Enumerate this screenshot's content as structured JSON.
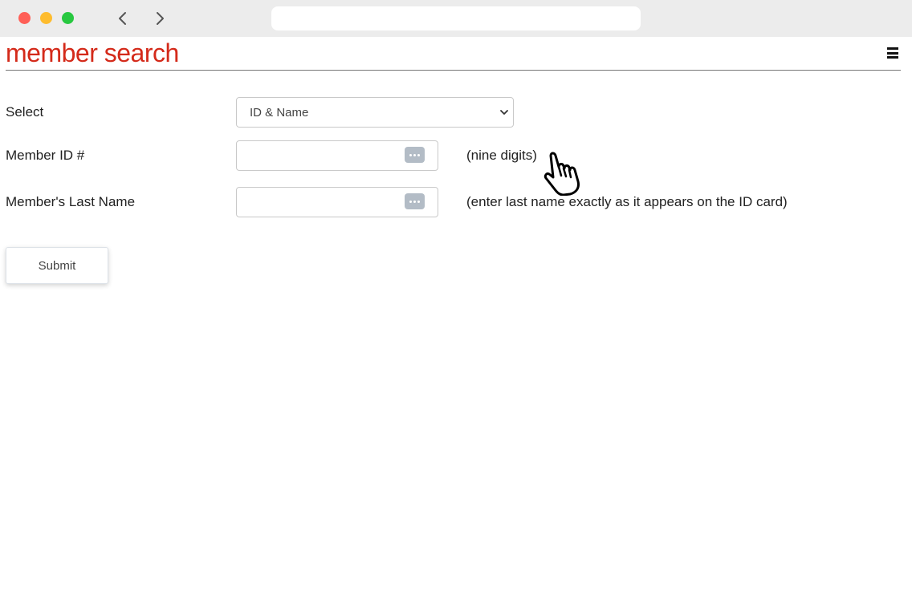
{
  "icons": {
    "back": "chevron-left-icon",
    "forward": "chevron-right-icon",
    "menu": "hamburger-menu-icon",
    "select_arrow": "chevron-down-icon",
    "password_manager": "key-ellipsis-icon",
    "cursor": "pointer-hand-icon"
  },
  "colors": {
    "title": "#d42a1a",
    "close": "#ff5f57",
    "minimize": "#febc2e",
    "maximize": "#28c840"
  },
  "page": {
    "title": "member search"
  },
  "form": {
    "select_label": "Select",
    "select_value": "ID & Name",
    "member_id_label": "Member ID #",
    "member_id_value": "",
    "member_id_hint": "(nine digits)",
    "last_name_label": "Member's Last Name",
    "last_name_value": "",
    "last_name_hint": "(enter last name exactly as it appears on the ID card)",
    "submit_label": "Submit"
  }
}
